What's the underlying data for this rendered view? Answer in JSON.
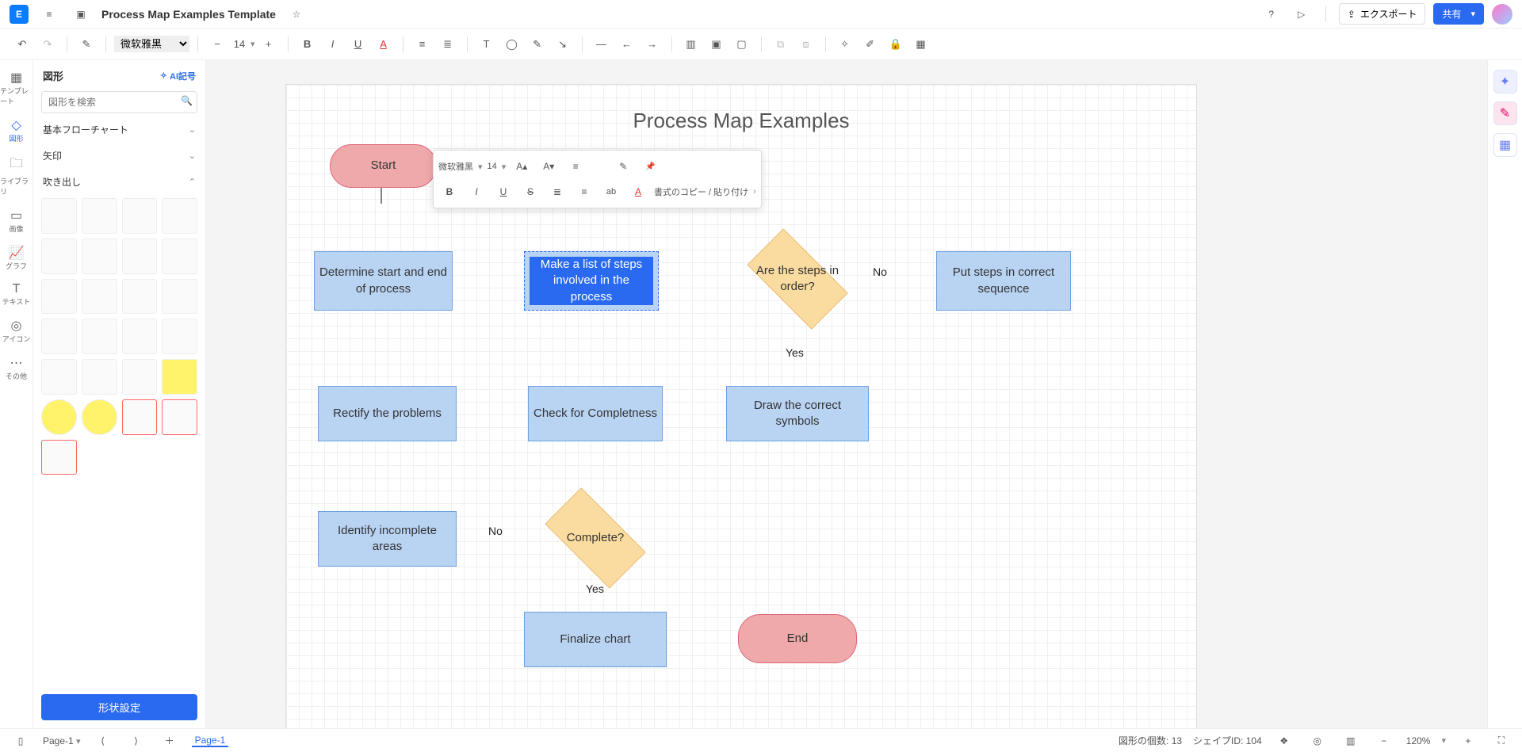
{
  "doc": {
    "title": "Process Map Examples Template"
  },
  "titlebar": {
    "export": "エクスポート",
    "share": "共有"
  },
  "toolbar": {
    "font": "微软雅黑",
    "fontsize": "14"
  },
  "leftrail": {
    "template": "テンプレート",
    "shapes": "図形",
    "library": "ライブラリ",
    "image": "画像",
    "graph": "グラフ",
    "text": "テキスト",
    "icon": "アイコン",
    "other": "その他"
  },
  "shapes": {
    "title": "図形",
    "ai": "AI記号",
    "search_ph": "図形を検索",
    "sec_basic": "基本フローチャート",
    "sec_arrow": "矢印",
    "sec_callout": "吹き出し",
    "footer_btn": "形状設定"
  },
  "float": {
    "font": "微软雅黑",
    "size": "14",
    "copy": "書式のコピー / 貼り付け"
  },
  "chart": {
    "title": "Process Map Examples",
    "start": "Start",
    "n1": "Determine start and end of process",
    "n2": "Make a list of steps involved in the process",
    "d1": "Are the steps in order?",
    "n3": "Put steps in correct sequence",
    "n4": "Draw the correct symbols",
    "n5": "Check for Completness",
    "n6": "Rectify the problems",
    "d2": "Complete?",
    "n7": "Identify incomplete areas",
    "n8": "Finalize chart",
    "end": "End",
    "no": "No",
    "yes": "Yes"
  },
  "status": {
    "page_sel": "Page-1",
    "page_tab": "Page-1",
    "shape_count_label": "図形の個数:",
    "shape_count": "13",
    "shape_id_label": "シェイプID:",
    "shape_id": "104",
    "zoom": "120%"
  }
}
